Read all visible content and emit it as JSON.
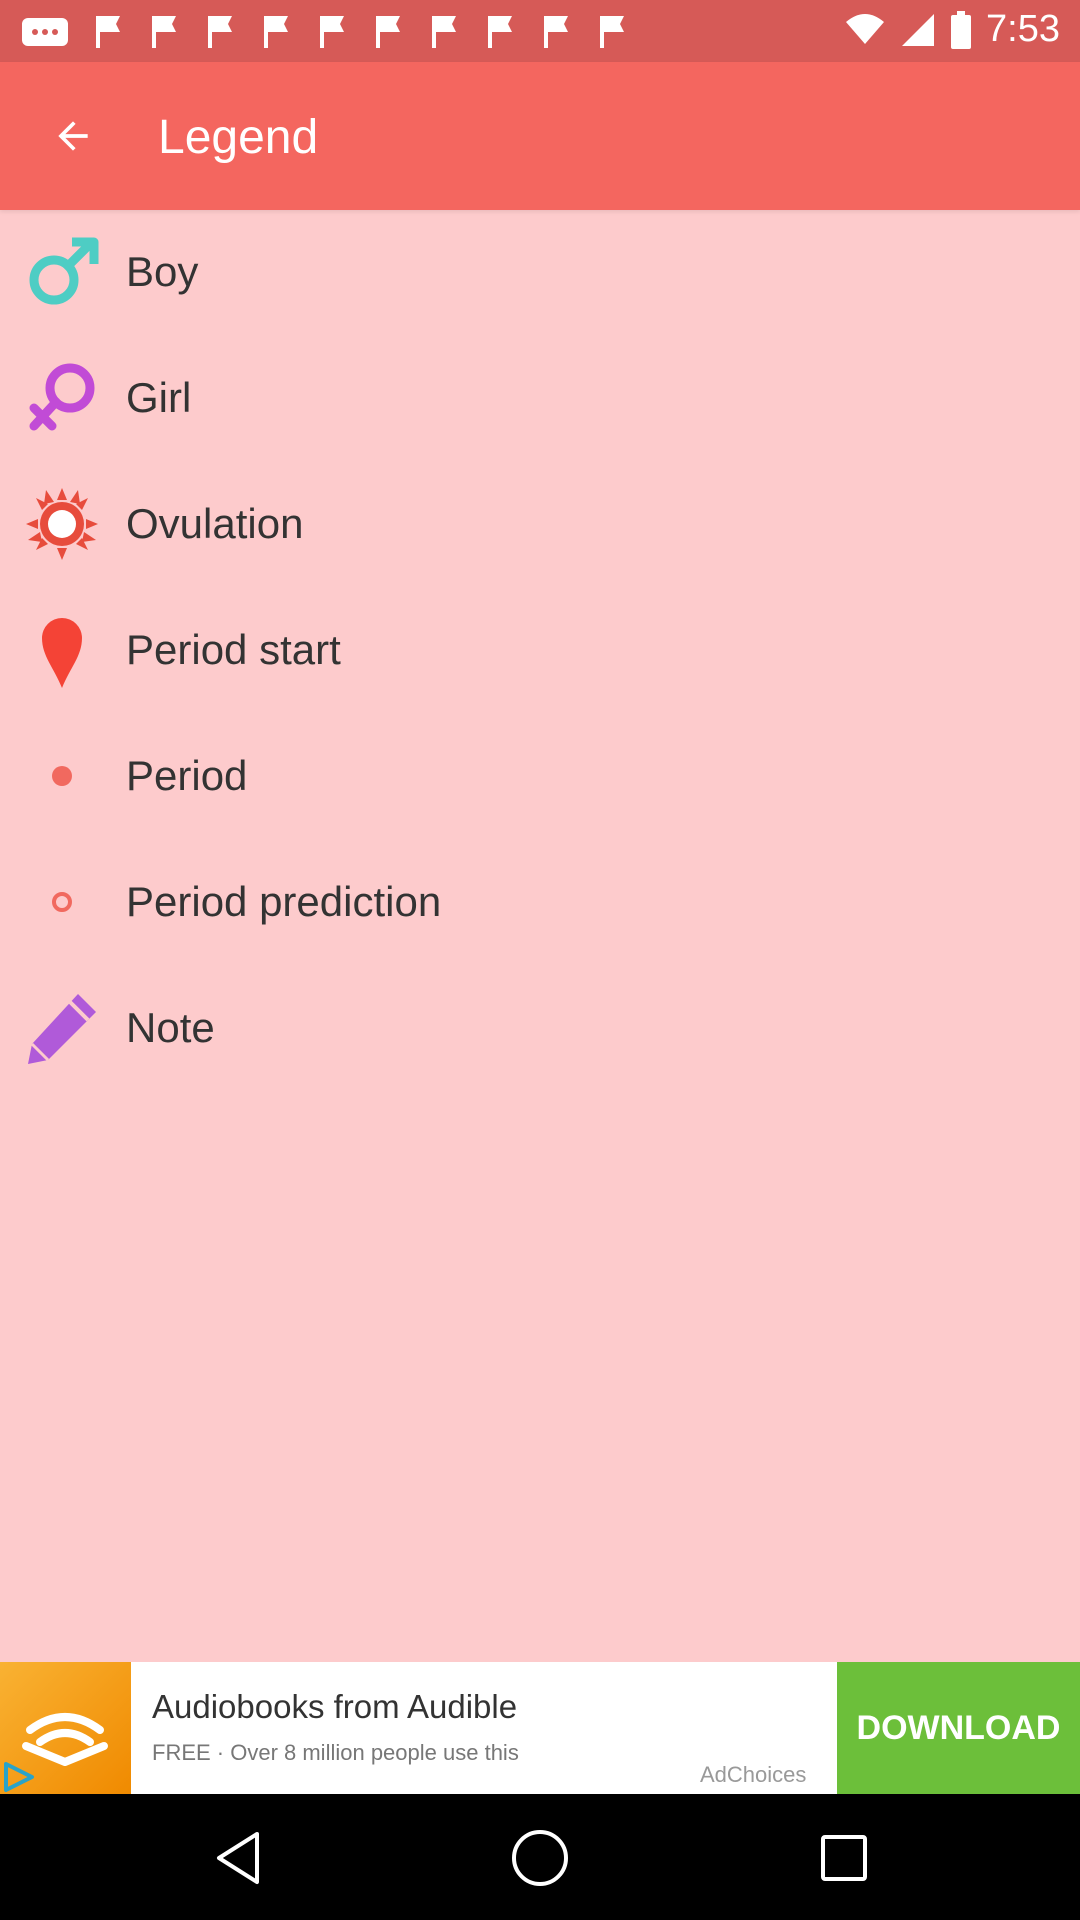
{
  "status_bar": {
    "time": "7:53"
  },
  "app_bar": {
    "title": "Legend"
  },
  "legend": {
    "items": [
      {
        "label": "Boy",
        "icon": "male-symbol-icon",
        "color": "#4ecdc4"
      },
      {
        "label": "Girl",
        "icon": "female-symbol-icon",
        "color": "#c14bd6"
      },
      {
        "label": "Ovulation",
        "icon": "sun-icon",
        "color": "#e74c3c"
      },
      {
        "label": "Period start",
        "icon": "drop-pin-icon",
        "color": "#f44336"
      },
      {
        "label": "Period",
        "icon": "dot-icon",
        "color": "#f1695f"
      },
      {
        "label": "Period prediction",
        "icon": "ring-icon",
        "color": "#f1695f"
      },
      {
        "label": "Note",
        "icon": "pencil-icon",
        "color": "#b05ad9"
      }
    ]
  },
  "ad": {
    "title": "Audiobooks from Audible",
    "subtitle": "FREE · Over 8 million people use this",
    "ad_choices": "AdChoices",
    "cta": "DOWNLOAD"
  },
  "colors": {
    "status_bar": "#d65a57",
    "app_bar": "#f4665f",
    "background": "#fdcbcc",
    "cta": "#6cbf3a"
  }
}
